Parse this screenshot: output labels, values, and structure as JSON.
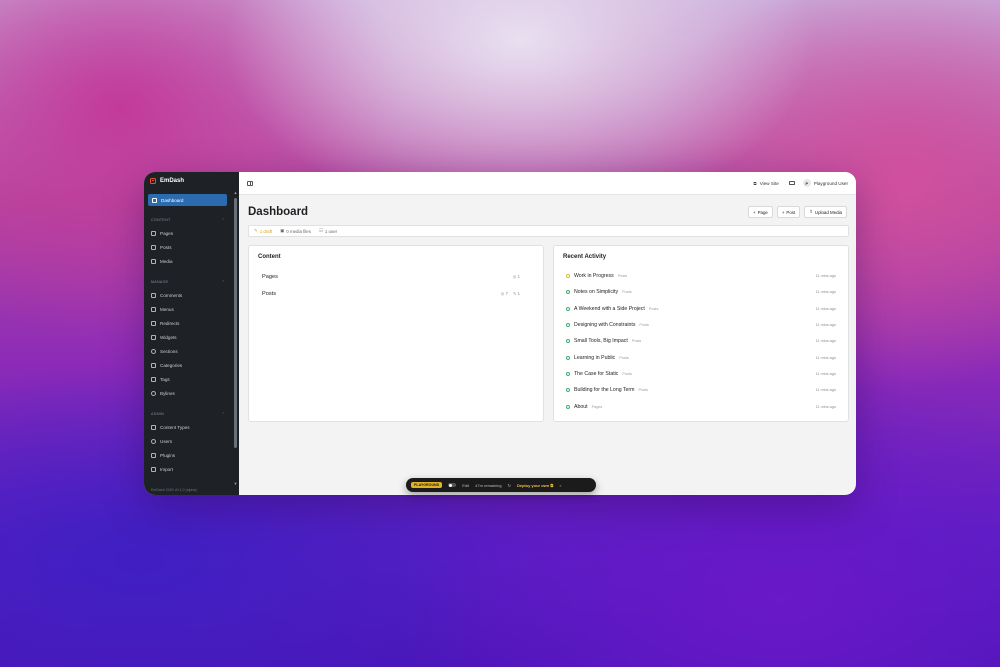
{
  "sidebar": {
    "brand": "EmDash",
    "active_item": "Dashboard",
    "sections": [
      {
        "label": "CONTENT",
        "items": [
          "Pages",
          "Posts",
          "Media"
        ]
      },
      {
        "label": "MANAGE",
        "items": [
          "Comments",
          "Menus",
          "Redirects",
          "Widgets",
          "Sections",
          "Categories",
          "Tags",
          "Bylines"
        ]
      },
      {
        "label": "ADMIN",
        "items": [
          "Content Types",
          "Users",
          "Plugins",
          "Import"
        ]
      }
    ],
    "footer": "EmDash CMS v0.1.0 (alpha)"
  },
  "topbar": {
    "view_site": "View Site",
    "user_initial": "P",
    "user_name": "Playground User"
  },
  "page": {
    "title": "Dashboard",
    "buttons": {
      "page": "Page",
      "post": "Post",
      "upload": "Upload Media"
    }
  },
  "stats": {
    "drafts": "1 draft",
    "media": "0 media files",
    "users": "1 user"
  },
  "content_card": {
    "title": "Content",
    "rows": [
      {
        "name": "Pages",
        "meta1": "1",
        "meta2": ""
      },
      {
        "name": "Posts",
        "meta1": "7",
        "meta2": "1"
      }
    ]
  },
  "activity_card": {
    "title": "Recent Activity",
    "items": [
      {
        "title": "Work in Progress",
        "type": "Posts",
        "time": "11 mins ago",
        "status": "draft"
      },
      {
        "title": "Notes on Simplicity",
        "type": "Posts",
        "time": "11 mins ago",
        "status": "published"
      },
      {
        "title": "A Weekend with a Side Project",
        "type": "Posts",
        "time": "11 mins ago",
        "status": "published"
      },
      {
        "title": "Designing with Constraints",
        "type": "Posts",
        "time": "11 mins ago",
        "status": "published"
      },
      {
        "title": "Small Tools, Big Impact",
        "type": "Posts",
        "time": "11 mins ago",
        "status": "published"
      },
      {
        "title": "Learning in Public",
        "type": "Posts",
        "time": "11 mins ago",
        "status": "published"
      },
      {
        "title": "The Case for Static",
        "type": "Posts",
        "time": "11 mins ago",
        "status": "published"
      },
      {
        "title": "Building for the Long Term",
        "type": "Posts",
        "time": "11 mins ago",
        "status": "published"
      },
      {
        "title": "About",
        "type": "Pages",
        "time": "11 mins ago",
        "status": "published"
      }
    ]
  },
  "playground": {
    "badge": "PLAYGROUND",
    "edit": "Edit",
    "remaining": "47m remaining",
    "deploy": "Deploy your own",
    "close": "×"
  },
  "colors": {
    "accent": "#2b6cb0",
    "sidebar_bg": "#1e2226",
    "draft": "#e2b93b",
    "published": "#3bb273",
    "brand": "#e8502f"
  }
}
